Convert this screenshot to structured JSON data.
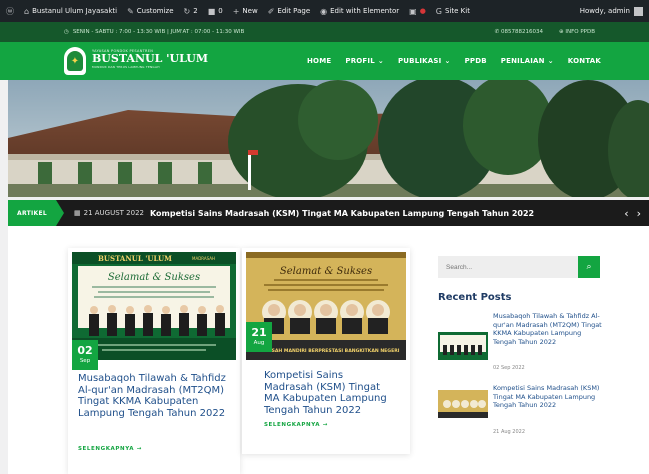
{
  "adminbar": {
    "site": "Bustanul Ulum Jayasakti",
    "customize": "Customize",
    "updates": "2",
    "comments": "0",
    "new": "New",
    "edit_page": "Edit Page",
    "elementor": "Edit with Elementor",
    "sitekit": "Site Kit",
    "howdy": "Howdy, admin"
  },
  "infobar": {
    "hours": "SENIN - SABTU : 7:00 - 13:30 WIB | JUM'AT : 07:00 - 11:30 WIB",
    "phone": "085788216034",
    "ppdb": "INFO PPDB"
  },
  "brand": {
    "small": "YAYASAN PONDOK PESANTREN",
    "name": "BUSTANUL 'ULUM",
    "tag": "MUNDUR DAN TERUS LAMPUNG TENGAH"
  },
  "nav": [
    {
      "label": "HOME",
      "caret": ""
    },
    {
      "label": "PROFIL",
      "caret": "⌄"
    },
    {
      "label": "PUBLIKASI",
      "caret": "⌄"
    },
    {
      "label": "PPDB",
      "caret": ""
    },
    {
      "label": "PENILAIAN",
      "caret": "⌄"
    },
    {
      "label": "KONTAK",
      "caret": ""
    }
  ],
  "ticker": {
    "label": "ARTIKEL",
    "date": "21 AUGUST 2022",
    "title": "Kompetisi Sains Madrasah (KSM) Tingat MA Kabupaten Lampung Tengah Tahun 2022",
    "prev": "‹",
    "next": "›"
  },
  "posts": [
    {
      "day": "02",
      "month": "Sep",
      "title": "Musabaqoh Tilawah & Tahfidz Al-qur'an Madrasah (MT2QM) Tingat KKMA Kabupaten Lampung Tengah Tahun 2022",
      "read_more": "SELENGKAPNYA →",
      "banner_school": "BUSTANUL 'ULUM",
      "banner_head": "Selamat & Sukses",
      "banner_sub": "MADRASAH"
    },
    {
      "day": "21",
      "month": "Aug",
      "title": "Kompetisi Sains Madrasah (KSM) Tingat MA Kabupaten Lampung Tengah Tahun 2022",
      "read_more": "SELENGKAPNYA →",
      "banner_head": "Selamat & Sukses",
      "banner_foot": "MADRASAH MANDIRI BERPRESTASI BANGKITKAN NEGERI"
    }
  ],
  "sidebar": {
    "search_placeholder": "Search...",
    "recent_title": "Recent Posts",
    "recent": [
      {
        "title": "Musabaqoh Tilawah & Tahfidz Al-qur'an Madrasah (MT2QM) Tingat KKMA Kabupaten Lampung Tengah Tahun 2022",
        "date": "02 Sep 2022"
      },
      {
        "title": "Kompetisi Sains Madrasah (KSM) Tingat MA Kabupaten Lampung Tengah Tahun 2022",
        "date": "21 Aug 2022"
      }
    ]
  },
  "colors": {
    "accent": "#13a541",
    "dark_green": "#15582b",
    "link": "#1f4f8a"
  }
}
